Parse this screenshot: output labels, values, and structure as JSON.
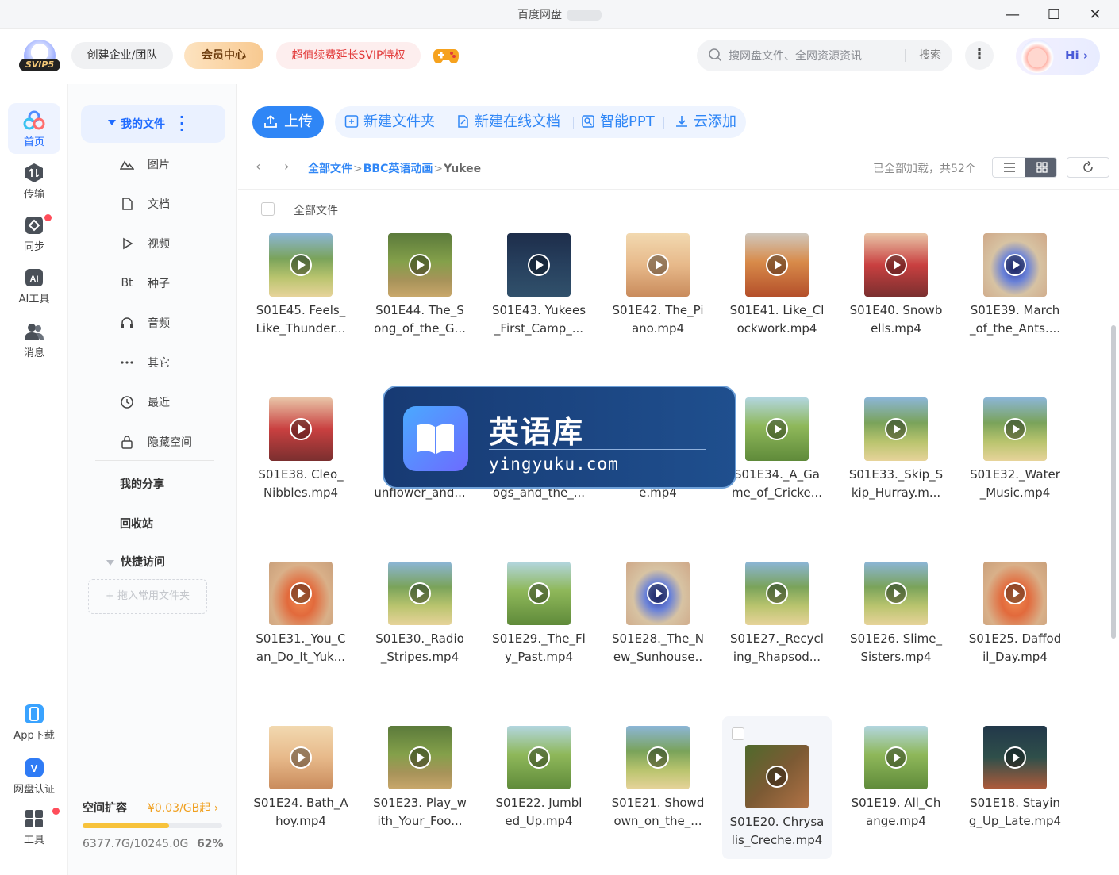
{
  "window": {
    "title": "百度网盘",
    "minimize": "—",
    "maximize": "☐",
    "close": "✕"
  },
  "header": {
    "logo_text": "SVIP5",
    "team_btn": "创建企业/团队",
    "vip_btn": "会员中心",
    "promo_btn": "超值续费延长SVIP特权",
    "search": {
      "placeholder": "搜网盘文件、全网资源资讯",
      "button": "搜索"
    },
    "more": "⋮",
    "hi": "Hi ›"
  },
  "rail": {
    "items": [
      {
        "label": "首页",
        "icon": "home-icon"
      },
      {
        "label": "传输",
        "icon": "transfer-icon"
      },
      {
        "label": "同步",
        "icon": "sync-icon"
      },
      {
        "label": "AI工具",
        "icon": "ai-icon"
      },
      {
        "label": "消息",
        "icon": "message-icon"
      }
    ],
    "bottom": [
      {
        "label": "App下载",
        "icon": "phone-icon"
      },
      {
        "label": "网盘认证",
        "icon": "verify-icon"
      },
      {
        "label": "工具",
        "icon": "tools-icon"
      }
    ]
  },
  "nav": {
    "my_files": "我的文件",
    "subs": [
      {
        "label": "图片",
        "icon": "image-icon"
      },
      {
        "label": "文档",
        "icon": "doc-icon"
      },
      {
        "label": "视频",
        "icon": "video-icon"
      },
      {
        "label": "种子",
        "icon": "bt-icon",
        "glyph": "Bt"
      },
      {
        "label": "音频",
        "icon": "audio-icon"
      },
      {
        "label": "其它",
        "icon": "other-icon"
      },
      {
        "label": "最近",
        "icon": "recent-icon"
      },
      {
        "label": "隐藏空间",
        "icon": "lock-icon"
      }
    ],
    "my_share": "我的分享",
    "recycle": "回收站",
    "quick": "快捷访问",
    "quick_drop": "+ 拖入常用文件夹",
    "storage": {
      "label": "空间扩容",
      "price": "¥0.03/GB起 ›",
      "used": "6377.7G/10245.0G",
      "percent": "62%",
      "fraction": 0.62
    }
  },
  "toolbar": {
    "upload": "上传",
    "new_folder": "新建文件夹",
    "new_doc": "新建在线文档",
    "ppt": "智能PPT",
    "cloud_add": "云添加"
  },
  "breadcrumb": {
    "root": "全部文件",
    "folder": "BBC英语动画",
    "current": "Yukee",
    "sep": ">",
    "status": "已全部加载，共52个"
  },
  "list": {
    "header": "全部文件"
  },
  "watermark": {
    "title": "英语库",
    "url": "yingyuku.com"
  },
  "files": [
    {
      "line1": "S01E45. Feels_",
      "line2": "Like_Thunder...",
      "theme": "p-grass"
    },
    {
      "line1": "S01E44. The_S",
      "line2": "ong_of_the_G...",
      "theme": "p-forest"
    },
    {
      "line1": "S01E43. Yukees",
      "line2": "_First_Camp_...",
      "theme": "p-night"
    },
    {
      "line1": "S01E42. The_Pi",
      "line2": "ano.mp4",
      "theme": "p-room"
    },
    {
      "line1": "S01E41. Like_Cl",
      "line2": "ockwork.mp4",
      "theme": "p-fox"
    },
    {
      "line1": "S01E40. Snowb",
      "line2": "ells.mp4",
      "theme": "p-red"
    },
    {
      "line1": "S01E39. March",
      "line2": "_of_the_Ants....",
      "theme": "p-blue"
    },
    {
      "line1": "S01E38. Cleo_",
      "line2": "Nibbles.mp4",
      "theme": "p-red"
    },
    {
      "line1": "",
      "line2": "unflower_and...",
      "theme": "p-grass"
    },
    {
      "line1": "",
      "line2": "ogs_and_the_...",
      "theme": "p-grass"
    },
    {
      "line1": "",
      "line2": "e.mp4",
      "theme": "p-grass"
    },
    {
      "line1": "S01E34._A_Ga",
      "line2": "me_of_Cricke...",
      "theme": "p-jungle"
    },
    {
      "line1": "S01E33._Skip_S",
      "line2": "kip_Hurray.m...",
      "theme": "p-grass"
    },
    {
      "line1": "S01E32._Water",
      "line2": "_Music.mp4",
      "theme": "p-grass"
    },
    {
      "line1": "S01E31._You_C",
      "line2": "an_Do_It_Yuk...",
      "theme": "p-orange"
    },
    {
      "line1": "S01E30._Radio",
      "line2": "_Stripes.mp4",
      "theme": "p-grass"
    },
    {
      "line1": "S01E29._The_Fl",
      "line2": "y_Past.mp4",
      "theme": "p-jungle"
    },
    {
      "line1": "S01E28._The_N",
      "line2": "ew_Sunhouse..",
      "theme": "p-blue"
    },
    {
      "line1": "S01E27._Recycl",
      "line2": "ing_Rhapsod...",
      "theme": "p-grass"
    },
    {
      "line1": "S01E26. Slime_",
      "line2": "Sisters.mp4",
      "theme": "p-grass"
    },
    {
      "line1": "S01E25. Daffod",
      "line2": "il_Day.mp4",
      "theme": "p-orange"
    },
    {
      "line1": "S01E24. Bath_A",
      "line2": "hoy.mp4",
      "theme": "p-room"
    },
    {
      "line1": "S01E23. Play_w",
      "line2": "ith_Your_Foo...",
      "theme": "p-forest"
    },
    {
      "line1": "S01E22. Jumbl",
      "line2": "ed_Up.mp4",
      "theme": "p-jungle"
    },
    {
      "line1": "S01E21. Showd",
      "line2": "own_on_the_...",
      "theme": "p-grass"
    },
    {
      "line1": "S01E20. Chrysa",
      "line2": "lis_Creche.mp4",
      "theme": "p-bark"
    },
    {
      "line1": "S01E19. All_Ch",
      "line2": "ange.mp4",
      "theme": "p-jungle"
    },
    {
      "line1": "S01E18. Stayin",
      "line2": "g_Up_Late.mp4",
      "theme": "p-dark"
    }
  ]
}
